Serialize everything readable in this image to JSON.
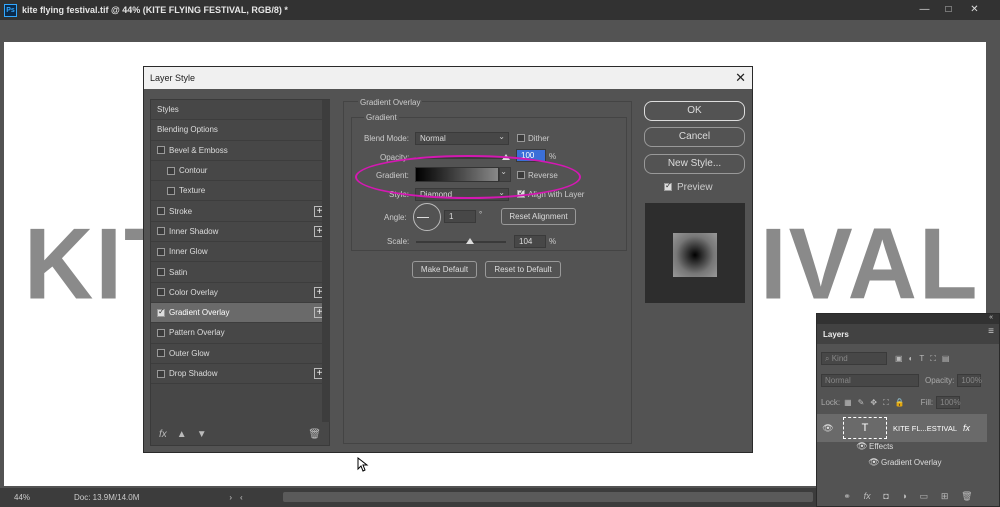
{
  "window": {
    "title": "kite flying festival.tif @ 44% (KITE FLYING FESTIVAL, RGB/8) *",
    "app_icon": "Ps"
  },
  "canvas": {
    "text_left": "KITE",
    "text_right": "IVAL"
  },
  "status": {
    "zoom": "44%",
    "doc": "Doc: 13.9M/14.0M"
  },
  "dialog": {
    "title": "Layer Style",
    "styles": [
      {
        "label": "Styles",
        "checkbox": false,
        "plus": false
      },
      {
        "label": "Blending Options",
        "checkbox": false,
        "plus": false
      },
      {
        "label": "Bevel & Emboss",
        "checkbox": true,
        "checked": false,
        "plus": false
      },
      {
        "label": "Contour",
        "checkbox": true,
        "checked": false,
        "plus": false,
        "sub": true
      },
      {
        "label": "Texture",
        "checkbox": true,
        "checked": false,
        "plus": false,
        "sub": true
      },
      {
        "label": "Stroke",
        "checkbox": true,
        "checked": false,
        "plus": true
      },
      {
        "label": "Inner Shadow",
        "checkbox": true,
        "checked": false,
        "plus": true
      },
      {
        "label": "Inner Glow",
        "checkbox": true,
        "checked": false,
        "plus": false
      },
      {
        "label": "Satin",
        "checkbox": true,
        "checked": false,
        "plus": false
      },
      {
        "label": "Color Overlay",
        "checkbox": true,
        "checked": false,
        "plus": true
      },
      {
        "label": "Gradient Overlay",
        "checkbox": true,
        "checked": true,
        "plus": true,
        "active": true
      },
      {
        "label": "Pattern Overlay",
        "checkbox": true,
        "checked": false,
        "plus": false
      },
      {
        "label": "Outer Glow",
        "checkbox": true,
        "checked": false,
        "plus": false
      },
      {
        "label": "Drop Shadow",
        "checkbox": true,
        "checked": false,
        "plus": true
      }
    ],
    "fx_label": "fx",
    "section_title": "Gradient Overlay",
    "subsection_title": "Gradient",
    "blend_mode_label": "Blend Mode:",
    "blend_mode_value": "Normal",
    "dither_label": "Dither",
    "opacity_label": "Opacity:",
    "opacity_value": "100",
    "opacity_level": 1.0,
    "percent": "%",
    "gradient_label": "Gradient:",
    "reverse_label": "Reverse",
    "style_label": "Style:",
    "style_value": "Diamond",
    "align_label": "Align with Layer",
    "angle_label": "Angle:",
    "angle_value": "1",
    "degree": "°",
    "reset_alignment": "Reset Alignment",
    "scale_label": "Scale:",
    "scale_value": "104",
    "make_default": "Make Default",
    "reset_default": "Reset to Default",
    "ok": "OK",
    "cancel": "Cancel",
    "new_style": "New Style...",
    "preview_label": "Preview",
    "highlight_color": "#d418b2"
  },
  "layers": {
    "tab": "Layers",
    "kind": "Kind",
    "blend": "Normal",
    "opacity_label": "Opacity:",
    "opacity": "100%",
    "lock_label": "Lock:",
    "fill_label": "Fill:",
    "fill": "100%",
    "layer_name": "KITE FL...ESTIVAL",
    "layer_thumb": "T",
    "effects": "Effects",
    "effect_item": "Gradient Overlay"
  }
}
